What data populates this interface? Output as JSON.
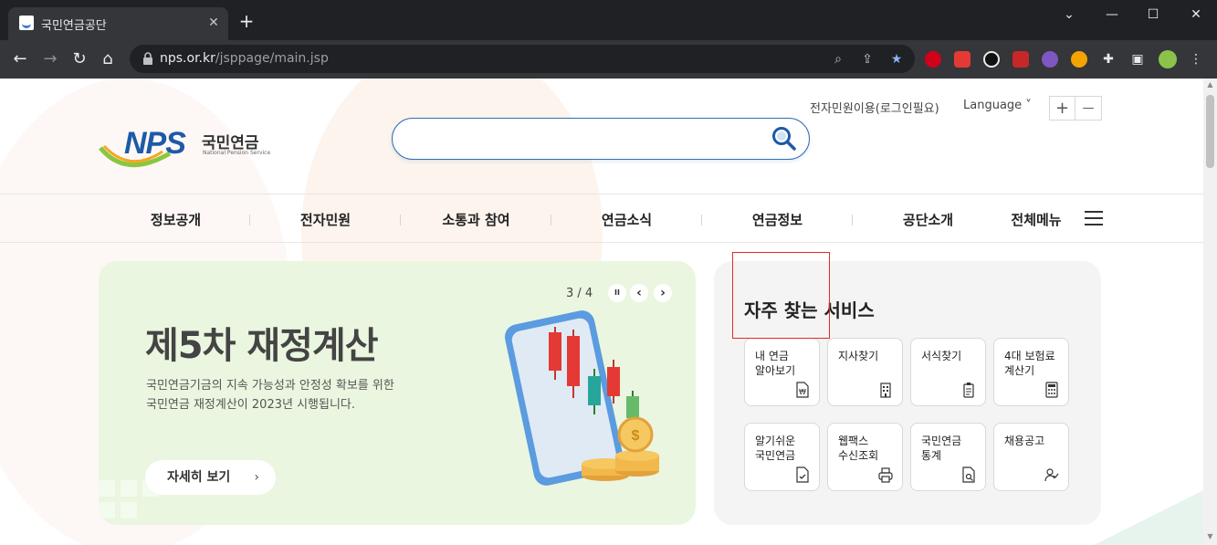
{
  "browser": {
    "tab_title": "국민연금공단",
    "tab_close": "✕",
    "new_tab": "+",
    "url_host": "nps.or.kr",
    "url_path": "/jsppage/main.jsp",
    "window_controls": [
      "⌄",
      "—",
      "☐",
      "✕"
    ]
  },
  "header": {
    "util_login": "전자민원이용(로그인필요)",
    "util_language": "Language ˅",
    "zoom_in": "+",
    "zoom_out": "—",
    "logo_mark": "NPS",
    "logo_text": "국민연금",
    "logo_sub": "National Pension Service",
    "search_placeholder": ""
  },
  "gnb": {
    "items": [
      "정보공개",
      "전자민원",
      "소통과 참여",
      "연금소식",
      "연금정보",
      "공단소개",
      "전체메뉴"
    ]
  },
  "banner": {
    "counter": "3 / 4",
    "pause": "II",
    "prev": "‹",
    "next": "›",
    "title": "제5차 재정계산",
    "desc_line1": "국민연금기금의 지속 가능성과 안정성 확보를 위한",
    "desc_line2": "국민연금 재정계산이 2023년 시행됩니다.",
    "button": "자세히 보기",
    "button_chevron": "›"
  },
  "services": {
    "title": "자주 찾는 서비스",
    "items": [
      {
        "label": "내 연금\n알아보기",
        "icon": "won-document-icon"
      },
      {
        "label": "지사찾기",
        "icon": "building-icon"
      },
      {
        "label": "서식찾기",
        "icon": "clipboard-icon"
      },
      {
        "label": "4대 보험료\n계산기",
        "icon": "calculator-icon"
      },
      {
        "label": "알기쉬운\n국민연금",
        "icon": "document-check-icon"
      },
      {
        "label": "웹팩스\n수신조회",
        "icon": "printer-icon"
      },
      {
        "label": "국민연금\n통계",
        "icon": "document-search-icon"
      },
      {
        "label": "채용공고",
        "icon": "person-check-icon"
      }
    ]
  },
  "colors": {
    "brand_blue": "#1d5aa8",
    "banner_bg": "#eaf6df",
    "highlight": "#e02b2b"
  }
}
